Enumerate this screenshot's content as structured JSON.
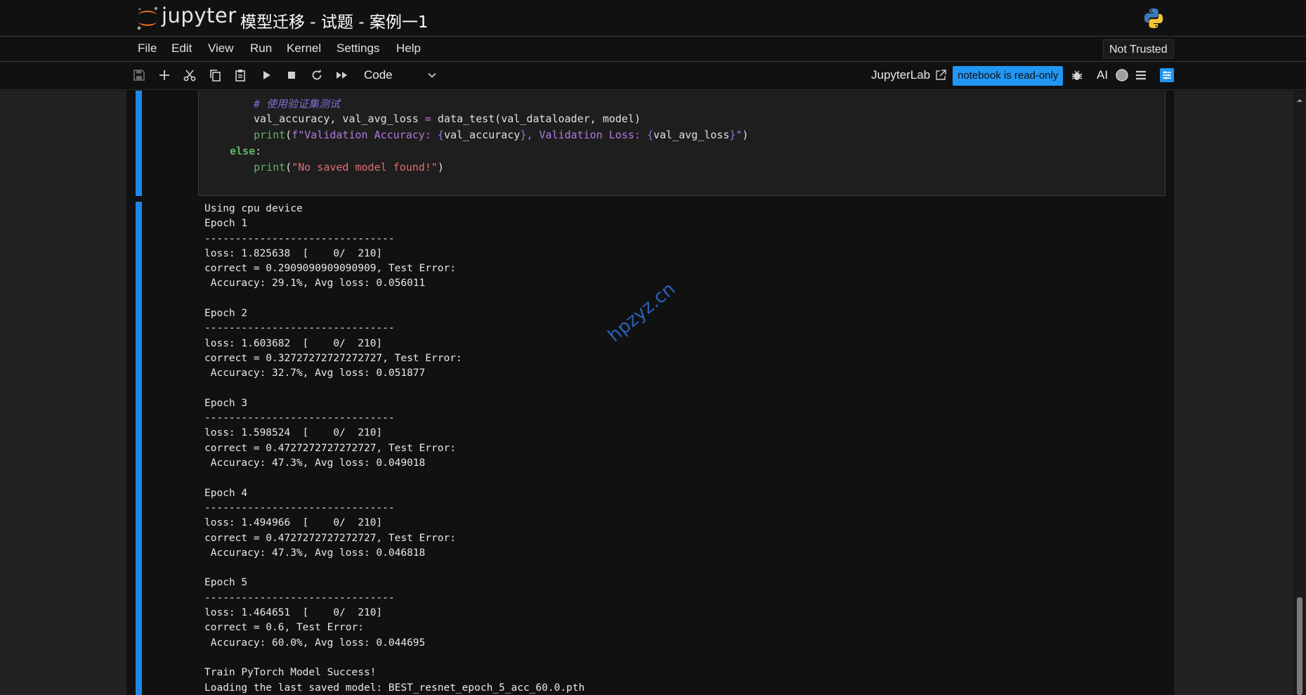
{
  "header": {
    "logo_text": "jupyter",
    "notebook_title": "模型迁移 - 试题 - 案例一1",
    "kernel_icon": "python-logo"
  },
  "menu": {
    "items": [
      "File",
      "Edit",
      "View",
      "Run",
      "Kernel",
      "Settings",
      "Help"
    ],
    "trust_status": "Not Trusted"
  },
  "toolbar": {
    "icons": [
      "save-icon",
      "add-cell-icon",
      "cut-icon",
      "copy-icon",
      "paste-icon",
      "run-icon",
      "stop-icon",
      "restart-icon",
      "run-all-icon"
    ],
    "cell_type": "Code",
    "jupyterlab_link": "JupyterLab",
    "readonly_badge": "notebook is read-only",
    "ai_label": "AI",
    "accent_color": "#2196f3"
  },
  "code_cell": {
    "comment": "# 使用验证集测试",
    "line2_a": "val_accuracy, val_avg_loss ",
    "line2_eq": "=",
    "line2_b": " data_test(val_dataloader, model)",
    "line3_print": "print",
    "line3_open": "(",
    "line3_f1": "f\"Validation Accuracy: ",
    "line3_b1": "{",
    "line3_v1": "val_accuracy",
    "line3_b2": "}",
    "line3_f2": ", Validation Loss: ",
    "line3_b3": "{",
    "line3_v2": "val_avg_loss",
    "line3_b4": "}",
    "line3_f3": "\"",
    "line3_close": ")",
    "else_kw": "else",
    "else_colon": ":",
    "line5_print": "print",
    "line5_open": "(",
    "line5_str": "\"No saved model found!\"",
    "line5_close": ")"
  },
  "output": {
    "text": "Using cpu device\nEpoch 1\n-------------------------------\nloss: 1.825638  [    0/  210]\ncorrect = 0.2909090909090909, Test Error: \n Accuracy: 29.1%, Avg loss: 0.056011 \n\nEpoch 2\n-------------------------------\nloss: 1.603682  [    0/  210]\ncorrect = 0.32727272727272727, Test Error: \n Accuracy: 32.7%, Avg loss: 0.051877 \n\nEpoch 3\n-------------------------------\nloss: 1.598524  [    0/  210]\ncorrect = 0.4727272727272727, Test Error: \n Accuracy: 47.3%, Avg loss: 0.049018 \n\nEpoch 4\n-------------------------------\nloss: 1.494966  [    0/  210]\ncorrect = 0.4727272727272727, Test Error: \n Accuracy: 47.3%, Avg loss: 0.046818 \n\nEpoch 5\n-------------------------------\nloss: 1.464651  [    0/  210]\ncorrect = 0.6, Test Error: \n Accuracy: 60.0%, Avg loss: 0.044695 \n\nTrain PyTorch Model Success!\nLoading the last saved model: BEST_resnet_epoch_5_acc_60.0.pth"
  },
  "watermark": "hpzyz.cn"
}
